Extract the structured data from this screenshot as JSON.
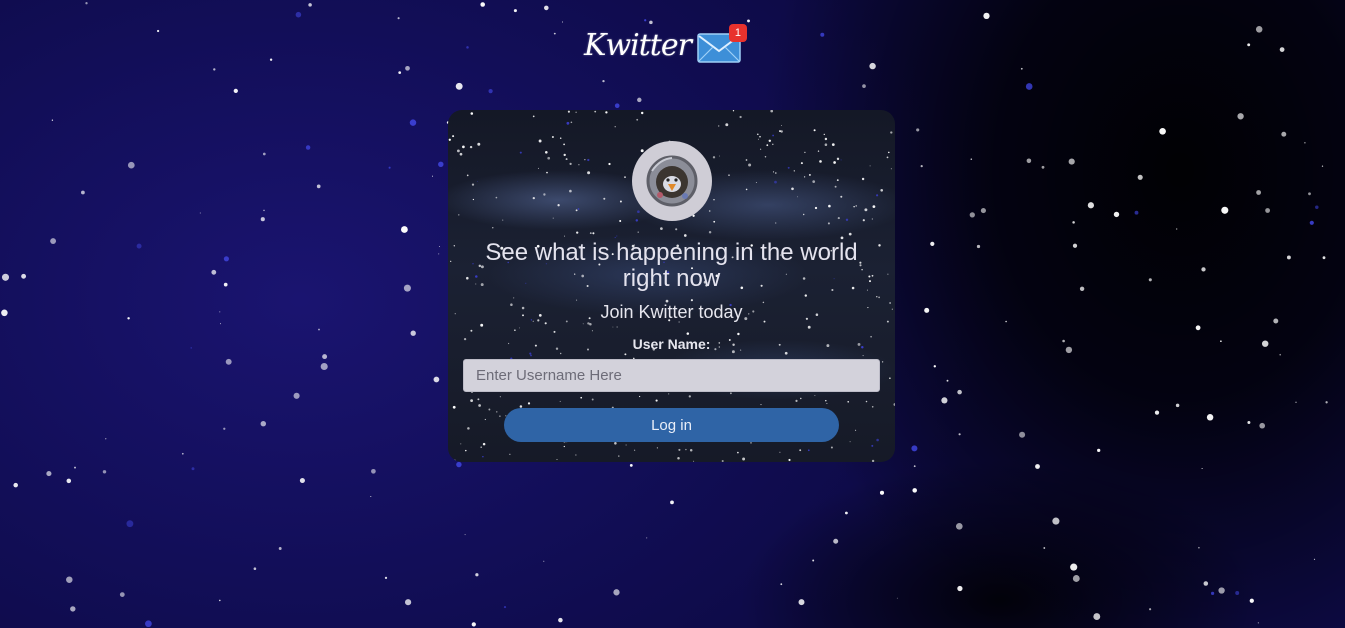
{
  "header": {
    "logo_text": "Kwitter",
    "mail_icon": "envelope-icon",
    "notification_count": "1"
  },
  "login_card": {
    "avatar_icon": "astronaut-avatar-icon",
    "headline": "See what is happening in the world right now",
    "subheadline": "Join Kwitter today",
    "username_label": "User Name:",
    "username_placeholder": "Enter Username Here",
    "username_value": "",
    "login_button_label": "Log in"
  },
  "colors": {
    "background": "#120e58",
    "card_background": "#161a27",
    "button": "#2f64a6",
    "input_background": "#d3d2db",
    "badge": "#e8322d",
    "envelope": "#3d8fd8"
  }
}
